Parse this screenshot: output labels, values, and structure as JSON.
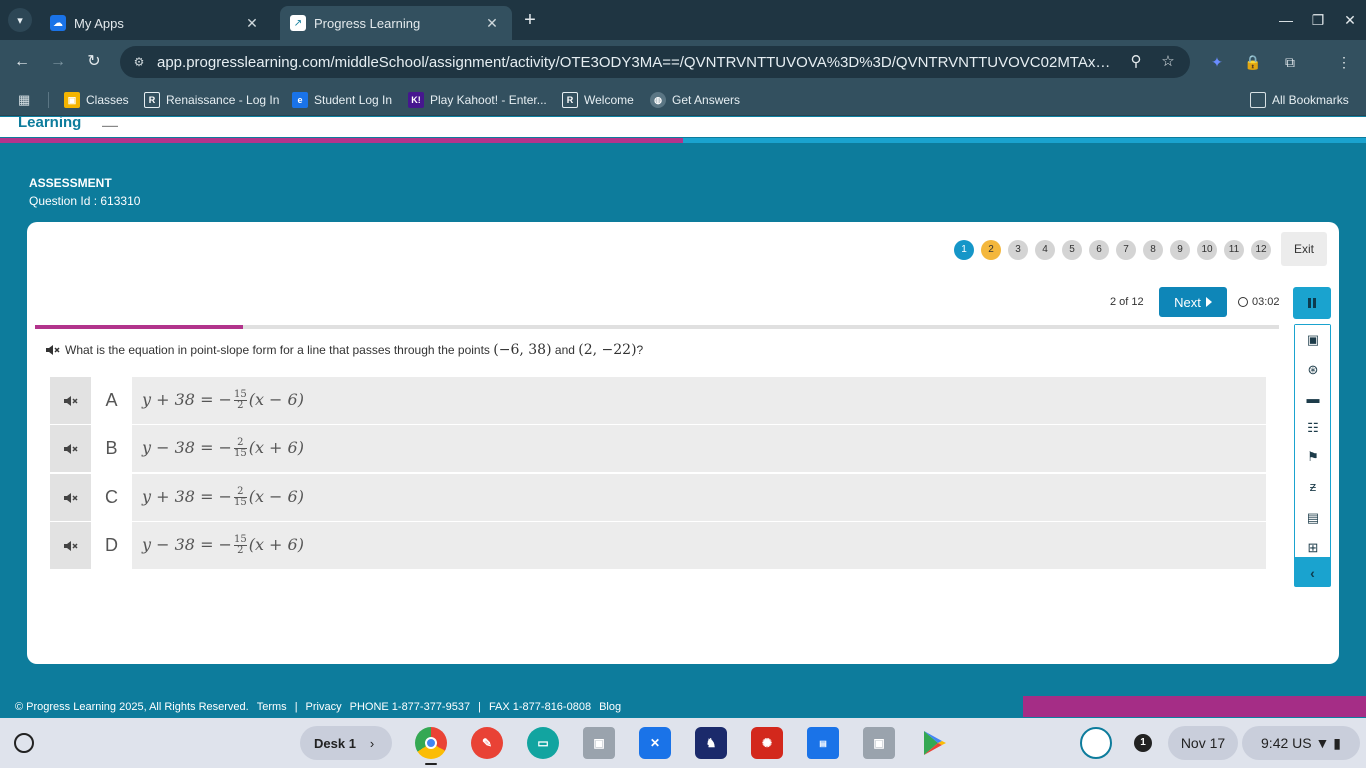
{
  "browser": {
    "tabs": [
      {
        "title": "My Apps",
        "close": "✕"
      },
      {
        "title": "Progress Learning",
        "close": "✕"
      }
    ],
    "new_tab": "+",
    "url": "app.progresslearning.com/middleSchool/assignment/activity/OTE3ODY3MA==/QVNTRVNTTUVOVA%3D%3D/QVNTRVNTTUVOVC02MTAxMzMyLWVu/...",
    "bookmarks": [
      "Classes",
      "Renaissance - Log In",
      "Student Log In",
      "Play Kahoot! - Enter...",
      "Welcome",
      "Get Answers"
    ],
    "all_bookmarks": "All Bookmarks"
  },
  "page": {
    "logo": "Learning",
    "section_title": "ASSESSMENT",
    "question_id": "Question Id : 613310",
    "question_numbers": [
      "1",
      "2",
      "3",
      "4",
      "5",
      "6",
      "7",
      "8",
      "9",
      "10",
      "11",
      "12"
    ],
    "exit_label": "Exit",
    "counter": "2 of 12",
    "next_label": "Next",
    "timer": "03:02",
    "progress_fraction": 0.167,
    "question": {
      "prefix": "What is the equation in point-slope form for a line that passes through the points",
      "point1": "(−6, 38)",
      "conj": "and",
      "point2": "(2, −22)",
      "suffix": "?"
    },
    "options": [
      {
        "letter": "A",
        "pre": "y + 38 = −",
        "num": "15",
        "den": "2",
        "post": "(x − 6)"
      },
      {
        "letter": "B",
        "pre": "y − 38 = −",
        "num": "2",
        "den": "15",
        "post": "(x + 6)"
      },
      {
        "letter": "C",
        "pre": "y + 38 = −",
        "num": "2",
        "den": "15",
        "post": "(x − 6)"
      },
      {
        "letter": "D",
        "pre": "y − 38 = −",
        "num": "15",
        "den": "2",
        "post": "(x + 6)"
      }
    ],
    "footer": {
      "copyright": "© Progress Learning 2025, All Rights Reserved.",
      "terms": "Terms",
      "sep": "|",
      "privacy": "Privacy",
      "phone": "PHONE 1-877-377-9537",
      "fax": "FAX 1-877-816-0808",
      "blog": "Blog"
    }
  },
  "shelf": {
    "desk": "Desk 1",
    "notifications": "1",
    "date": "Nov 17",
    "time": "9:42",
    "locale": "US"
  }
}
